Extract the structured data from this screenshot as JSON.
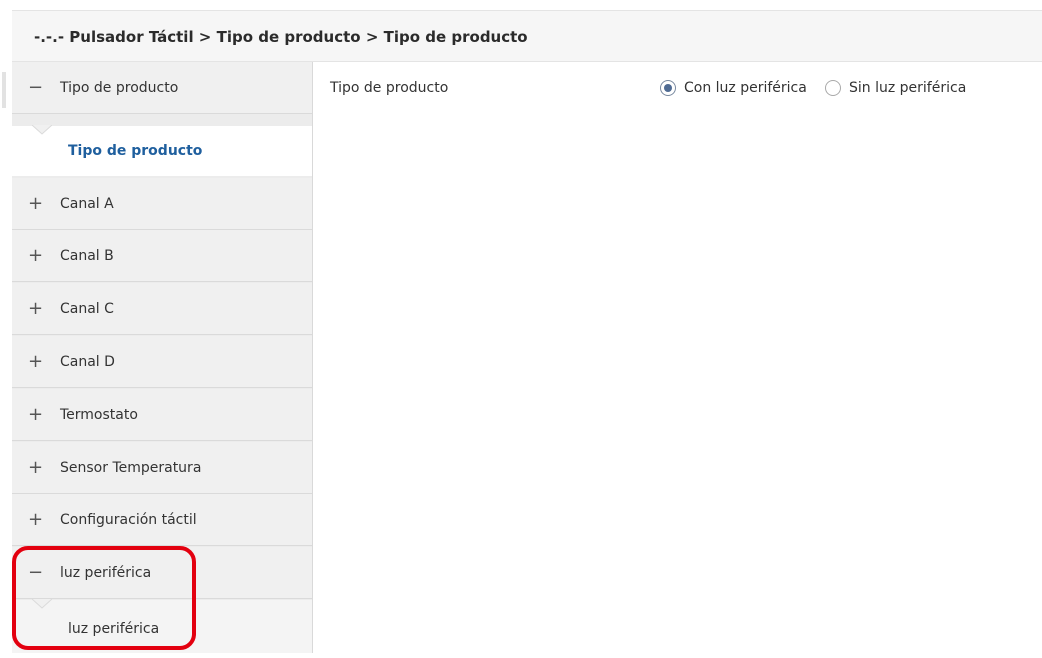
{
  "header": {
    "breadcrumb": "-.-.- Pulsador Táctil > Tipo de producto > Tipo de producto"
  },
  "sidebar": {
    "items": [
      {
        "sign": "−",
        "label": "Tipo de producto",
        "expanded": true
      },
      {
        "sign": "+",
        "label": "Canal A"
      },
      {
        "sign": "+",
        "label": "Canal B"
      },
      {
        "sign": "+",
        "label": "Canal C"
      },
      {
        "sign": "+",
        "label": "Canal D"
      },
      {
        "sign": "+",
        "label": "Termostato"
      },
      {
        "sign": "+",
        "label": "Sensor Temperatura"
      },
      {
        "sign": "+",
        "label": "Configuración táctil"
      },
      {
        "sign": "−",
        "label": "luz periférica",
        "expanded": true
      }
    ],
    "subitems": {
      "tipo_de_producto": "Tipo de producto",
      "luz_periferica": "luz periférica"
    }
  },
  "main": {
    "parameter": {
      "label": "Tipo de producto",
      "options": [
        {
          "label": "Con luz periférica",
          "selected": true
        },
        {
          "label": "Sin luz periférica",
          "selected": false
        }
      ]
    }
  },
  "annotation": {
    "color": "#e3000f"
  },
  "colors": {
    "active_link": "#1f5f9e",
    "sidebar_bg": "#f0f0f0"
  }
}
